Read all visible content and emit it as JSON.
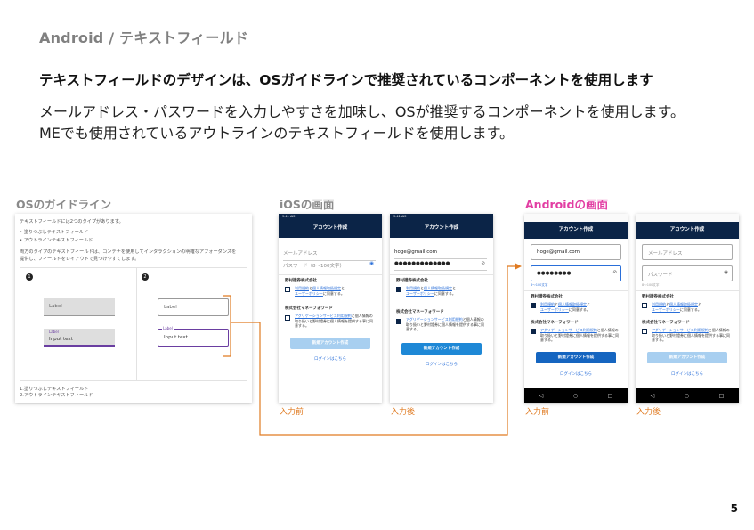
{
  "breadcrumb": "Android / テキストフィールド",
  "headline": "テキストフィールドのデザインは、OSガイドラインで推奨されているコンポーネントを使用します",
  "body": {
    "line1": "メールアドレス・パスワードを入力しやすさを加味し、OSが推奨するコンポーネントを使用します。",
    "line2": "MEでも使用されているアウトラインのテキストフィールドを使用します。"
  },
  "sections": {
    "guideline": "OSのガイドライン",
    "ios": "iOSの画面",
    "android": "Androidの画面"
  },
  "guideline_card": {
    "intro": "テキストフィールドには2つのタイプがあります。",
    "bullet1": "塗りつぶしテキストフィールド",
    "bullet2": "アウトラインテキストフィールド",
    "para1": "両方のタイプのテキストフィールドは、コンテナを使用してインタラクションの明確なアフォーダンスを",
    "para2": "提供し、フィールドをレイアウトで見つけやすくします。",
    "num1": "1",
    "num2": "2",
    "label": "Label",
    "input_text": "Input text",
    "foot1": "1.塗りつぶしテキストフィールド",
    "foot2": "2.アウトラインテキストフィールド"
  },
  "screens": {
    "status_time": "9:41 AM",
    "title": "アカウント作成",
    "email_placeholder": "メールアドレス",
    "email_value": "hoge@gmail.com",
    "password_placeholder": "パスワード（8〜100文字）",
    "password_placeholder_short": "パスワード",
    "password_masked": "●●●●●●●●●●●●●",
    "password_masked_short": "●●●●●●●●",
    "password_hint": "8〜100文字",
    "company1": "野村證券株式会社",
    "company2": "株式会社マネーフォワード",
    "consent1_link1": "利用規約",
    "consent1_mid": "と",
    "consent1_link2": "個人情報取扱規定",
    "consent1_link3": "ユーザーポリシー",
    "consent1_end": "に同意する。",
    "consent2_link": "アグリゲーションサービス利用規約",
    "consent2_text": "と個人情報の取り扱いと野村證券に個人情報を提供する事に同意する。",
    "create_button": "新規アカウント作成",
    "login_link": "ログインはこちら"
  },
  "captions": {
    "before": "入力前",
    "after": "入力後"
  },
  "nav_icons": {
    "back": "◁",
    "home": "○",
    "recent": "□"
  },
  "page_number": "5",
  "colors": {
    "accent_orange": "#e07b22",
    "android_pink": "#e23ea3",
    "navy": "#0b2447",
    "button_blue": "#1e88d6",
    "focus_purple": "#6a3ea1"
  }
}
